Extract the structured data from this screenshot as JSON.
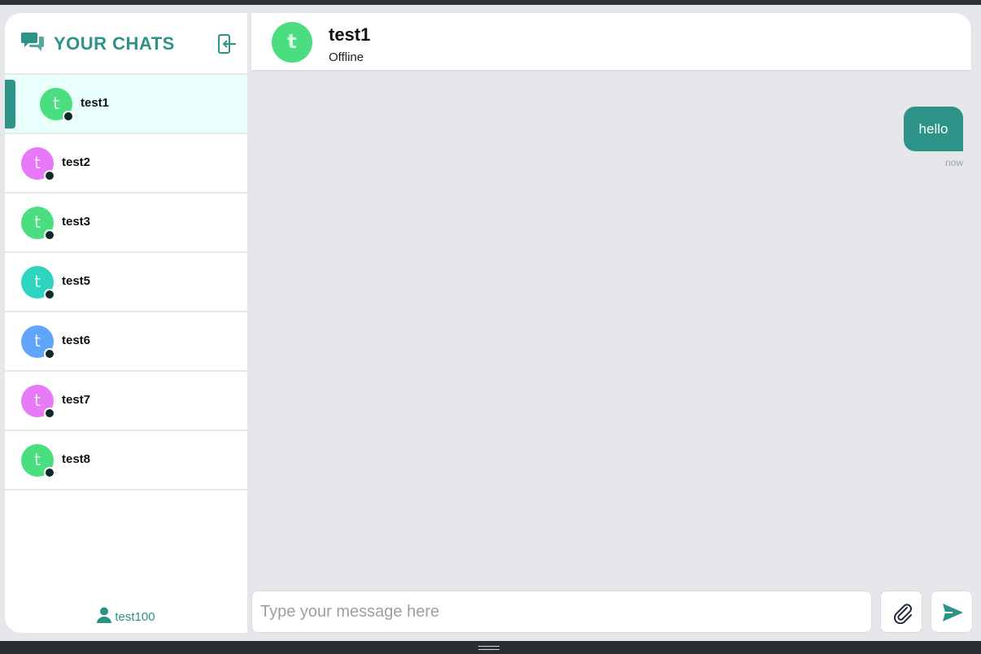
{
  "sidebar": {
    "title": "YOUR CHATS",
    "current_user": "test100",
    "chats": [
      {
        "name": "test1",
        "initial": "t",
        "color": "#4ade80",
        "active": true
      },
      {
        "name": "test2",
        "initial": "t",
        "color": "#e879f9",
        "active": false
      },
      {
        "name": "test3",
        "initial": "t",
        "color": "#4ade80",
        "active": false
      },
      {
        "name": "test5",
        "initial": "t",
        "color": "#2dd4bf",
        "active": false
      },
      {
        "name": "test6",
        "initial": "t",
        "color": "#60a5fa",
        "active": false
      },
      {
        "name": "test7",
        "initial": "t",
        "color": "#e879f9",
        "active": false
      },
      {
        "name": "test8",
        "initial": "t",
        "color": "#4ade80",
        "active": false
      }
    ]
  },
  "header": {
    "initial": "t",
    "name": "test1",
    "status": "Offline"
  },
  "messages": [
    {
      "text": "hello",
      "time": "now",
      "outgoing": true
    }
  ],
  "composer": {
    "placeholder": "Type your message here"
  },
  "colors": {
    "accent": "#2d9287",
    "active_row": "#e9fffc",
    "background": "#e5e7eb"
  },
  "icons": {
    "title": "chat-bubbles-icon",
    "logout": "logout-icon",
    "user": "user-icon",
    "attach": "paperclip-icon",
    "send": "send-icon"
  }
}
